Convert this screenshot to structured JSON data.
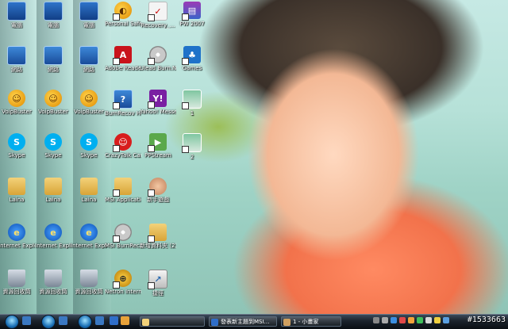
{
  "desktop": {
    "icons": [
      {
        "label": "電腦",
        "kind": "computer-icon",
        "cls": "pc",
        "glyph": ""
      },
      {
        "label": "電腦",
        "kind": "computer-icon",
        "cls": "pc",
        "glyph": ""
      },
      {
        "label": "電腦",
        "kind": "computer-icon",
        "cls": "pc",
        "glyph": ""
      },
      {
        "label": "網路",
        "kind": "network-icon",
        "cls": "net",
        "glyph": ""
      },
      {
        "label": "網路",
        "kind": "network-icon",
        "cls": "net",
        "glyph": ""
      },
      {
        "label": "網路",
        "kind": "network-icon",
        "cls": "net",
        "glyph": ""
      },
      {
        "label": "VoipBuster",
        "kind": "voipbuster-icon",
        "cls": "voip",
        "glyph": "☺"
      },
      {
        "label": "VoipBuster",
        "kind": "voipbuster-icon",
        "cls": "voip",
        "glyph": "☺"
      },
      {
        "label": "VoipBuster",
        "kind": "voipbuster-icon",
        "cls": "voip",
        "glyph": "☺"
      },
      {
        "label": "Skype",
        "kind": "skype-icon",
        "cls": "sky",
        "glyph": "S"
      },
      {
        "label": "Skype",
        "kind": "skype-icon",
        "cls": "sky",
        "glyph": "S"
      },
      {
        "label": "Skype",
        "kind": "skype-icon",
        "cls": "sky",
        "glyph": "S"
      },
      {
        "label": "Laina",
        "kind": "folder-icon",
        "cls": "fold",
        "glyph": ""
      },
      {
        "label": "Laina",
        "kind": "folder-icon",
        "cls": "fold",
        "glyph": ""
      },
      {
        "label": "Laina",
        "kind": "folder-icon",
        "cls": "fold",
        "glyph": ""
      },
      {
        "label": "Internet Explorer",
        "kind": "internet-explorer-icon",
        "cls": "ie",
        "glyph": "e"
      },
      {
        "label": "Internet Explorer",
        "kind": "internet-explorer-icon",
        "cls": "ie",
        "glyph": "e"
      },
      {
        "label": "Internet Explorer",
        "kind": "internet-explorer-icon",
        "cls": "ie",
        "glyph": "e"
      },
      {
        "label": "資源回收筒",
        "kind": "recycle-bin-icon",
        "cls": "bin",
        "glyph": ""
      },
      {
        "label": "資源回收筒",
        "kind": "recycle-bin-icon",
        "cls": "bin",
        "glyph": ""
      },
      {
        "label": "資源回收筒",
        "kind": "recycle-bin-icon",
        "cls": "bin",
        "glyph": ""
      },
      {
        "label": "Personal Safe",
        "kind": "safe-icon",
        "cls": "voip",
        "glyph": "◐"
      },
      {
        "label": "Adobe Reader 8",
        "kind": "adobe-reader-icon",
        "cls": "pdf",
        "glyph": "A"
      },
      {
        "label": "BurnRecov Help",
        "kind": "help-icon",
        "cls": "net",
        "glyph": "?"
      },
      {
        "label": "CrazyTalk Cam Suite",
        "kind": "crazytalk-icon",
        "cls": "crazy",
        "glyph": "☺"
      },
      {
        "label": "MSI Application",
        "kind": "folder-icon",
        "cls": "fold",
        "glyph": ""
      },
      {
        "label": "MSI BurnRecov...",
        "kind": "disc-icon",
        "cls": "disc",
        "glyph": ""
      },
      {
        "label": "Netron Intern...",
        "kind": "netron-icon",
        "cls": "nt",
        "glyph": "⊕"
      },
      {
        "label": "Recovery_...",
        "kind": "document-icon",
        "cls": "doc",
        "glyph": "✓"
      },
      {
        "label": "Ulead Burn.Now",
        "kind": "burn-disc-icon",
        "cls": "disc",
        "glyph": ""
      },
      {
        "label": "Yahoo! Messenger",
        "kind": "yahoo-messenger-icon",
        "cls": "yahoo",
        "glyph": "Y!"
      },
      {
        "label": "PPStream",
        "kind": "ppstream-icon",
        "cls": "ppstr",
        "glyph": "▶"
      },
      {
        "label": "新手遊戲",
        "kind": "game-icon",
        "cls": "face",
        "glyph": ""
      },
      {
        "label": "新增資料夾 (2)",
        "kind": "folder-icon",
        "cls": "fold",
        "glyph": ""
      },
      {
        "label": "捷徑",
        "kind": "shortcut-icon",
        "cls": "msnb",
        "glyph": "↗"
      },
      {
        "label": "PW 2007",
        "kind": "winrar-icon",
        "cls": "rar",
        "glyph": "▤"
      },
      {
        "label": "Games",
        "kind": "games-icon",
        "cls": "gl",
        "glyph": "♣"
      },
      {
        "label": "1",
        "kind": "image-icon",
        "cls": "img",
        "glyph": ""
      },
      {
        "label": "2",
        "kind": "image-icon",
        "cls": "img",
        "glyph": ""
      }
    ]
  },
  "taskbar": {
    "windows": [
      {
        "label": "",
        "icon": "folder-icon"
      },
      {
        "label": "發表新主題到MSI…",
        "icon": "internet-explorer-icon"
      },
      {
        "label": "1 - 小畫家",
        "icon": "paint-icon"
      }
    ],
    "clock": "",
    "watermark": "#1533663",
    "colors": {
      "accent": "#1a6fb5",
      "ie": "#0b4fb5",
      "folder": "#f3d27a"
    }
  }
}
